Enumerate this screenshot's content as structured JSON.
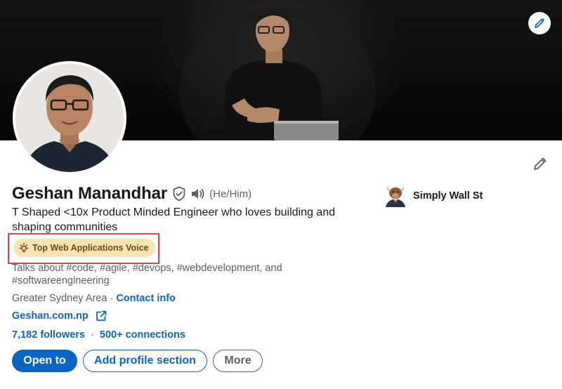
{
  "profile": {
    "name": "Geshan Manandhar",
    "pronouns": "(He/Him)",
    "headline": "T Shaped <10x Product Minded Engineer who loves building and shaping communities",
    "badge": "Top Web Applications Voice",
    "talks_about": "Talks about #code, #agile, #devops, #webdevelopment, and #softwareengineering",
    "location": "Greater Sydney Area",
    "separator": "·",
    "contact_info": "Contact info",
    "website": "Geshan.com.np",
    "followers": "7,182 followers",
    "connections": "500+ connections"
  },
  "actions": {
    "open_to": "Open to",
    "add_section": "Add profile section",
    "more": "More"
  },
  "company": {
    "name": "Simply Wall St"
  },
  "icons": {
    "cover_edit": "pencil-icon",
    "intro_edit": "pencil-icon",
    "verify": "shield-check-icon",
    "speaker": "speaker-icon",
    "badge": "lightbulb-icon",
    "external": "external-link-icon",
    "company_logo": "bull-logo"
  },
  "colors": {
    "accent": "#0a66c2",
    "badge_bg": "#f8e3b4",
    "badge_text": "#6f4a0f",
    "highlight_outline": "#d9473a"
  }
}
